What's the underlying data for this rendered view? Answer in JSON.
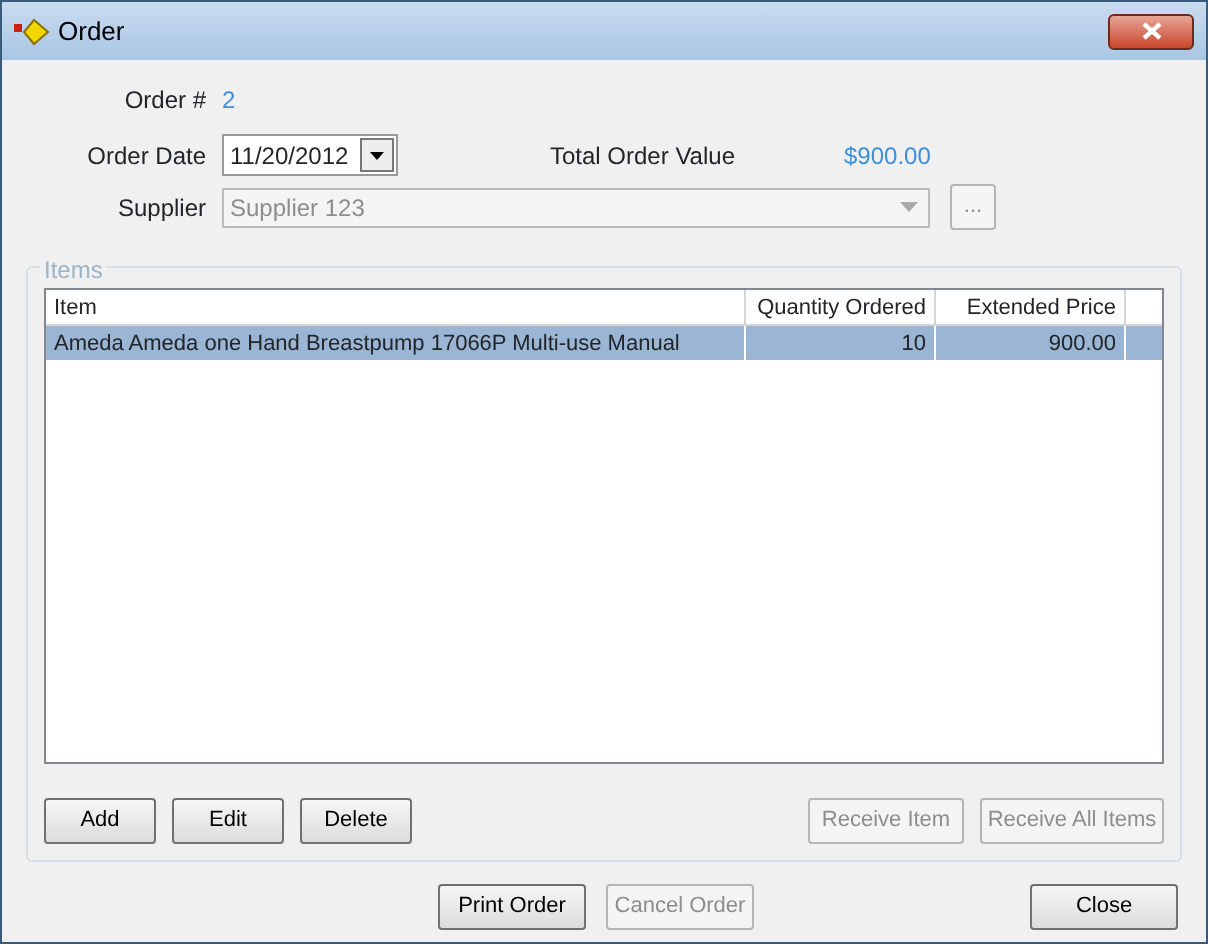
{
  "window": {
    "title": "Order"
  },
  "order_number": {
    "label": "Order #",
    "value": "2"
  },
  "order_date": {
    "label": "Order Date",
    "value": "11/20/2012"
  },
  "total": {
    "label": "Total Order Value",
    "value": "$900.00"
  },
  "supplier": {
    "label": "Supplier",
    "value": "Supplier 123",
    "disabled": true,
    "browse_label": "...",
    "browse_disabled": true
  },
  "items": {
    "title": "Items",
    "disabled": true,
    "columns": [
      "Item",
      "Quantity Ordered",
      "Extended Price"
    ],
    "rows": [
      {
        "cells": [
          "Ameda Ameda one  Hand Breastpump 17066P Multi-use Manual",
          "10",
          "900.00"
        ],
        "selected": true
      }
    ],
    "buttons": [
      {
        "label": "Add",
        "disabled": false
      },
      {
        "label": "Edit",
        "disabled": false
      },
      {
        "label": "Delete",
        "disabled": false
      },
      {
        "label": "Receive Item",
        "disabled": true
      },
      {
        "label": "Receive All Items",
        "disabled": true
      }
    ]
  },
  "buttons": [
    {
      "label": "Print Order",
      "disabled": false
    },
    {
      "label": "Cancel Order",
      "disabled": true
    },
    {
      "label": "Close",
      "disabled": false
    }
  ]
}
